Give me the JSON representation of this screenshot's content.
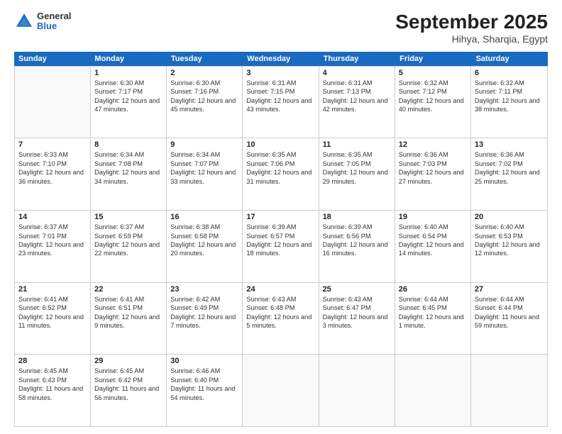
{
  "header": {
    "logo_general": "General",
    "logo_blue": "Blue",
    "title": "September 2025",
    "subtitle": "Hihya, Sharqia, Egypt"
  },
  "days_of_week": [
    "Sunday",
    "Monday",
    "Tuesday",
    "Wednesday",
    "Thursday",
    "Friday",
    "Saturday"
  ],
  "weeks": [
    [
      {
        "day": "",
        "sunrise": "",
        "sunset": "",
        "daylight": ""
      },
      {
        "day": "1",
        "sunrise": "Sunrise: 6:30 AM",
        "sunset": "Sunset: 7:17 PM",
        "daylight": "Daylight: 12 hours and 47 minutes."
      },
      {
        "day": "2",
        "sunrise": "Sunrise: 6:30 AM",
        "sunset": "Sunset: 7:16 PM",
        "daylight": "Daylight: 12 hours and 45 minutes."
      },
      {
        "day": "3",
        "sunrise": "Sunrise: 6:31 AM",
        "sunset": "Sunset: 7:15 PM",
        "daylight": "Daylight: 12 hours and 43 minutes."
      },
      {
        "day": "4",
        "sunrise": "Sunrise: 6:31 AM",
        "sunset": "Sunset: 7:13 PM",
        "daylight": "Daylight: 12 hours and 42 minutes."
      },
      {
        "day": "5",
        "sunrise": "Sunrise: 6:32 AM",
        "sunset": "Sunset: 7:12 PM",
        "daylight": "Daylight: 12 hours and 40 minutes."
      },
      {
        "day": "6",
        "sunrise": "Sunrise: 6:32 AM",
        "sunset": "Sunset: 7:11 PM",
        "daylight": "Daylight: 12 hours and 38 minutes."
      }
    ],
    [
      {
        "day": "7",
        "sunrise": "Sunrise: 6:33 AM",
        "sunset": "Sunset: 7:10 PM",
        "daylight": "Daylight: 12 hours and 36 minutes."
      },
      {
        "day": "8",
        "sunrise": "Sunrise: 6:34 AM",
        "sunset": "Sunset: 7:08 PM",
        "daylight": "Daylight: 12 hours and 34 minutes."
      },
      {
        "day": "9",
        "sunrise": "Sunrise: 6:34 AM",
        "sunset": "Sunset: 7:07 PM",
        "daylight": "Daylight: 12 hours and 33 minutes."
      },
      {
        "day": "10",
        "sunrise": "Sunrise: 6:35 AM",
        "sunset": "Sunset: 7:06 PM",
        "daylight": "Daylight: 12 hours and 31 minutes."
      },
      {
        "day": "11",
        "sunrise": "Sunrise: 6:35 AM",
        "sunset": "Sunset: 7:05 PM",
        "daylight": "Daylight: 12 hours and 29 minutes."
      },
      {
        "day": "12",
        "sunrise": "Sunrise: 6:36 AM",
        "sunset": "Sunset: 7:03 PM",
        "daylight": "Daylight: 12 hours and 27 minutes."
      },
      {
        "day": "13",
        "sunrise": "Sunrise: 6:36 AM",
        "sunset": "Sunset: 7:02 PM",
        "daylight": "Daylight: 12 hours and 25 minutes."
      }
    ],
    [
      {
        "day": "14",
        "sunrise": "Sunrise: 6:37 AM",
        "sunset": "Sunset: 7:01 PM",
        "daylight": "Daylight: 12 hours and 23 minutes."
      },
      {
        "day": "15",
        "sunrise": "Sunrise: 6:37 AM",
        "sunset": "Sunset: 6:59 PM",
        "daylight": "Daylight: 12 hours and 22 minutes."
      },
      {
        "day": "16",
        "sunrise": "Sunrise: 6:38 AM",
        "sunset": "Sunset: 6:58 PM",
        "daylight": "Daylight: 12 hours and 20 minutes."
      },
      {
        "day": "17",
        "sunrise": "Sunrise: 6:39 AM",
        "sunset": "Sunset: 6:57 PM",
        "daylight": "Daylight: 12 hours and 18 minutes."
      },
      {
        "day": "18",
        "sunrise": "Sunrise: 6:39 AM",
        "sunset": "Sunset: 6:56 PM",
        "daylight": "Daylight: 12 hours and 16 minutes."
      },
      {
        "day": "19",
        "sunrise": "Sunrise: 6:40 AM",
        "sunset": "Sunset: 6:54 PM",
        "daylight": "Daylight: 12 hours and 14 minutes."
      },
      {
        "day": "20",
        "sunrise": "Sunrise: 6:40 AM",
        "sunset": "Sunset: 6:53 PM",
        "daylight": "Daylight: 12 hours and 12 minutes."
      }
    ],
    [
      {
        "day": "21",
        "sunrise": "Sunrise: 6:41 AM",
        "sunset": "Sunset: 6:52 PM",
        "daylight": "Daylight: 12 hours and 11 minutes."
      },
      {
        "day": "22",
        "sunrise": "Sunrise: 6:41 AM",
        "sunset": "Sunset: 6:51 PM",
        "daylight": "Daylight: 12 hours and 9 minutes."
      },
      {
        "day": "23",
        "sunrise": "Sunrise: 6:42 AM",
        "sunset": "Sunset: 6:49 PM",
        "daylight": "Daylight: 12 hours and 7 minutes."
      },
      {
        "day": "24",
        "sunrise": "Sunrise: 6:43 AM",
        "sunset": "Sunset: 6:48 PM",
        "daylight": "Daylight: 12 hours and 5 minutes."
      },
      {
        "day": "25",
        "sunrise": "Sunrise: 6:43 AM",
        "sunset": "Sunset: 6:47 PM",
        "daylight": "Daylight: 12 hours and 3 minutes."
      },
      {
        "day": "26",
        "sunrise": "Sunrise: 6:44 AM",
        "sunset": "Sunset: 6:45 PM",
        "daylight": "Daylight: 12 hours and 1 minute."
      },
      {
        "day": "27",
        "sunrise": "Sunrise: 6:44 AM",
        "sunset": "Sunset: 6:44 PM",
        "daylight": "Daylight: 11 hours and 59 minutes."
      }
    ],
    [
      {
        "day": "28",
        "sunrise": "Sunrise: 6:45 AM",
        "sunset": "Sunset: 6:43 PM",
        "daylight": "Daylight: 11 hours and 58 minutes."
      },
      {
        "day": "29",
        "sunrise": "Sunrise: 6:45 AM",
        "sunset": "Sunset: 6:42 PM",
        "daylight": "Daylight: 11 hours and 56 minutes."
      },
      {
        "day": "30",
        "sunrise": "Sunrise: 6:46 AM",
        "sunset": "Sunset: 6:40 PM",
        "daylight": "Daylight: 11 hours and 54 minutes."
      },
      {
        "day": "",
        "sunrise": "",
        "sunset": "",
        "daylight": ""
      },
      {
        "day": "",
        "sunrise": "",
        "sunset": "",
        "daylight": ""
      },
      {
        "day": "",
        "sunrise": "",
        "sunset": "",
        "daylight": ""
      },
      {
        "day": "",
        "sunrise": "",
        "sunset": "",
        "daylight": ""
      }
    ]
  ]
}
